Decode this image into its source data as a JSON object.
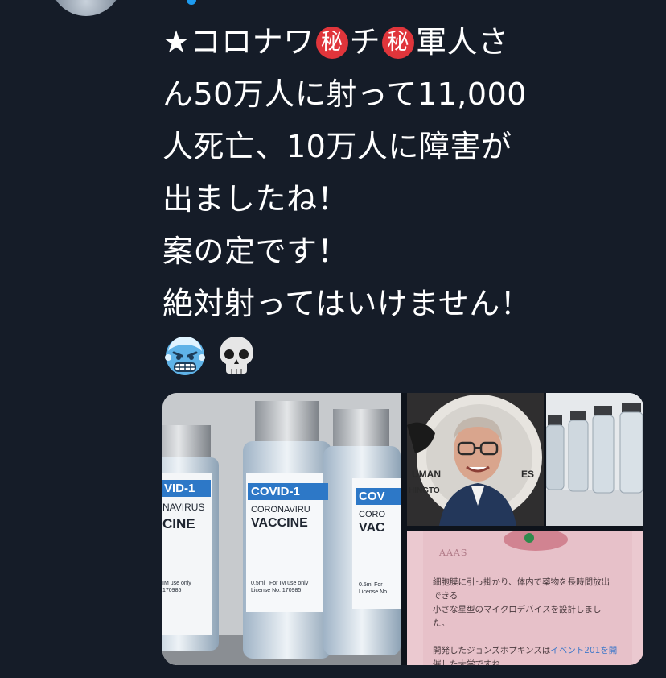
{
  "tweet": {
    "lines": [
      {
        "before": "★コロナワ",
        "seal1": "秘",
        "mid": "チ",
        "seal2": "秘",
        "after": "軍人さ"
      },
      "ん50万人に射って11,000",
      "人死亡、10万人に障害が",
      "出ましたね！",
      "案の定です！",
      "絶対射ってはいけません！"
    ],
    "emojis": [
      "cold-face-icon",
      "skull-icon"
    ]
  },
  "media": {
    "vaccine_photo": {
      "labels": [
        {
          "brand": "VID-1",
          "sub": "NAVIRUS",
          "main": "CINE",
          "dose": "",
          "info": "IM use only",
          "license": "170985"
        },
        {
          "brand": "COVID-1",
          "sub": "CORONAVIRU",
          "main": "VACCINE",
          "dose": "0.5ml",
          "info": "For IM use only",
          "license": "License No: 170985"
        },
        {
          "brand": "COV",
          "sub": "CORO",
          "main": "VAC",
          "dose": "0.5ml",
          "info": "For",
          "license": "License No"
        }
      ]
    },
    "portrait_photo": {
      "backdrop_text": [
        "UMAN",
        "ES",
        "HINGTO"
      ]
    },
    "vials_photo": {},
    "article": {
      "logo": "AAAS",
      "lines": [
        "細胞膜に引っ掛かり、体内で薬物を長時間放出",
        "できる",
        "小さな星型のマイクロデバイスを設計しまし",
        "た。",
        "",
        "開発したジョンズホプキンスは"
      ],
      "highlight": "イベント201を開",
      "tail": "催した大学ですね。"
    }
  },
  "colors": {
    "background": "#151c28",
    "text": "#ffffff",
    "seal": "#e0353b"
  }
}
